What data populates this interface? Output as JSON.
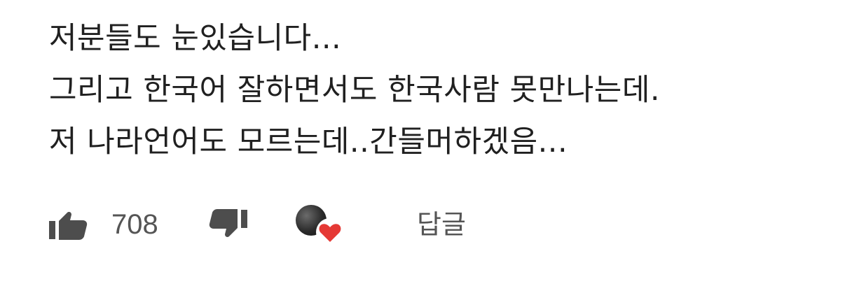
{
  "comment": {
    "lines": [
      "저분들도 눈있습니다...",
      "그리고 한국어 잘하면서도 한국사람 못만나는데.",
      "저 나라언어도 모르는데..간들머하겠음..."
    ]
  },
  "actions": {
    "like_count": "708",
    "reply_label": "답글"
  },
  "icons": {
    "like": "thumbs-up-icon",
    "dislike": "thumbs-down-icon",
    "creator_heart": "creator-heart-icon"
  },
  "colors": {
    "text": "#202020",
    "meta_text": "#555555",
    "heart": "#e53935"
  }
}
